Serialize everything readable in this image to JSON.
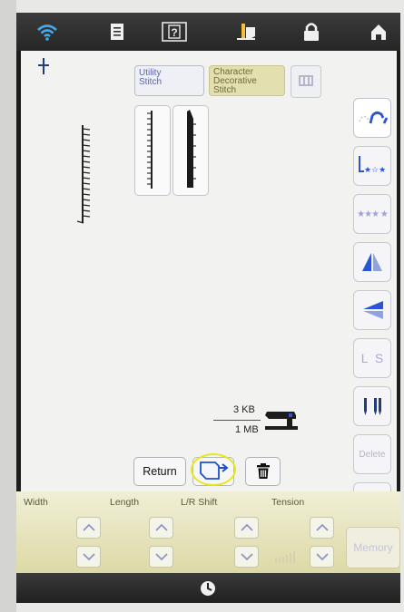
{
  "categories": {
    "utility_label": "Utility\nStitch",
    "character_label": "Character\nDecorative\nStitch"
  },
  "memory": {
    "used": "3 KB",
    "total": "1 MB"
  },
  "actions": {
    "return_label": "Return"
  },
  "panel": {
    "width_label": "Width",
    "length_label": "Length",
    "shift_label": "L/R Shift",
    "tension_label": "Tension",
    "memory_label": "Memory"
  },
  "side": {
    "ls_label": "L  S",
    "delete_label": "Delete"
  },
  "colors": {
    "highlight_ring": "#e6e81e",
    "accent_blue": "#2a53d8",
    "character_bg": "#e3dfae"
  },
  "icons": [
    "wifi-icon",
    "document-icon",
    "help-icon",
    "threading-icon",
    "lock-icon",
    "home-icon",
    "clock-icon",
    "trash-icon",
    "memory-save-icon",
    "sewing-machine-icon"
  ]
}
